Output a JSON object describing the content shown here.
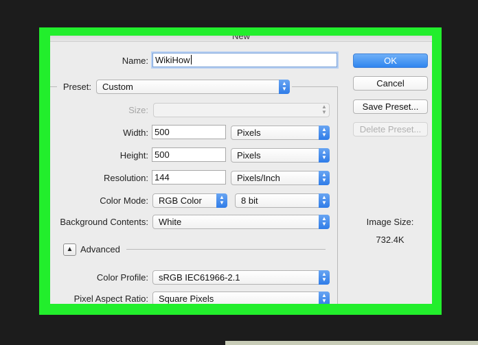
{
  "dialog": {
    "title": "New"
  },
  "form": {
    "name_label": "Name:",
    "name_value": "WikiHow",
    "preset_label": "Preset:",
    "preset_value": "Custom",
    "size_label": "Size:",
    "size_value": "",
    "width_label": "Width:",
    "width_value": "500",
    "width_unit": "Pixels",
    "height_label": "Height:",
    "height_value": "500",
    "height_unit": "Pixels",
    "resolution_label": "Resolution:",
    "resolution_value": "144",
    "resolution_unit": "Pixels/Inch",
    "color_mode_label": "Color Mode:",
    "color_mode_value": "RGB Color",
    "bit_depth_value": "8 bit",
    "background_label": "Background Contents:",
    "background_value": "White",
    "advanced_label": "Advanced",
    "color_profile_label": "Color Profile:",
    "color_profile_value": "sRGB IEC61966-2.1",
    "pixel_aspect_label": "Pixel Aspect Ratio:",
    "pixel_aspect_value": "Square Pixels"
  },
  "buttons": {
    "ok": "OK",
    "cancel": "Cancel",
    "save_preset": "Save Preset...",
    "delete_preset": "Delete Preset..."
  },
  "image_size": {
    "label": "Image Size:",
    "value": "732.4K"
  },
  "colors": {
    "highlight_frame": "#22ee2c",
    "accent": "#2f85ef",
    "dialog_bg": "#ececec"
  },
  "icons": {
    "stepper": "up-down-arrows-icon",
    "disclosure": "triangle-up-icon"
  }
}
